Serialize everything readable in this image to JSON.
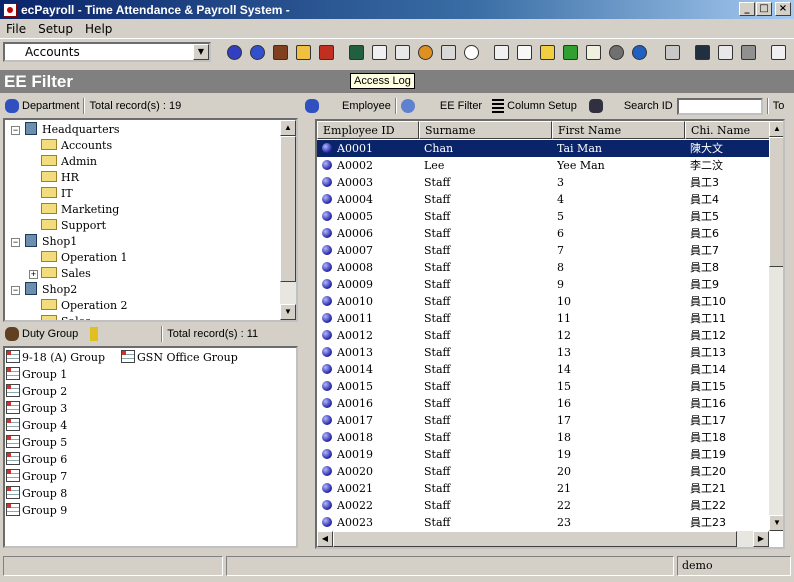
{
  "window": {
    "title": "ecPayroll - Time Attendance & Payroll System -"
  },
  "menu": [
    "File",
    "Setup",
    "Help"
  ],
  "toolbar": {
    "company_combo": "Accounts",
    "tooltip": "Access Log"
  },
  "section_title": "EE Filter",
  "department": {
    "label": "Department",
    "total": "Total record(s) : 19",
    "tree": [
      {
        "label": "Headquarters",
        "type": "building",
        "level": 0,
        "toggle": "−"
      },
      {
        "label": "Accounts",
        "type": "folder",
        "level": 1
      },
      {
        "label": "Admin",
        "type": "folder",
        "level": 1
      },
      {
        "label": "HR",
        "type": "folder",
        "level": 1
      },
      {
        "label": "IT",
        "type": "folder",
        "level": 1
      },
      {
        "label": "Marketing",
        "type": "folder",
        "level": 1
      },
      {
        "label": "Support",
        "type": "folder",
        "level": 1
      },
      {
        "label": "Shop1",
        "type": "building",
        "level": 0,
        "toggle": "−"
      },
      {
        "label": "Operation 1",
        "type": "folder",
        "level": 1
      },
      {
        "label": "Sales",
        "type": "folder",
        "level": 1,
        "toggle": "+"
      },
      {
        "label": "Shop2",
        "type": "building",
        "level": 0,
        "toggle": "−"
      },
      {
        "label": "Operation 2",
        "type": "folder",
        "level": 1
      },
      {
        "label": "Sales",
        "type": "folder",
        "level": 1
      }
    ]
  },
  "duty_group": {
    "label": "Duty Group",
    "total": "Total record(s) : 11",
    "groups": [
      "9-18 (A) Group",
      "GSN Office Group",
      "Group 1",
      "Group 2",
      "Group 3",
      "Group 4",
      "Group 5",
      "Group 6",
      "Group 7",
      "Group 8",
      "Group 9"
    ]
  },
  "employee_bar": {
    "employee": "Employee",
    "ee_filter": "EE Filter",
    "column_setup": "Column Setup",
    "search_id": "Search ID",
    "search_value": "",
    "to": "To"
  },
  "table": {
    "columns": [
      "Employee ID",
      "Surname",
      "First Name",
      "Chi. Name"
    ],
    "rows": [
      [
        "A0001",
        "Chan",
        "Tai Man",
        "陳大文"
      ],
      [
        "A0002",
        "Lee",
        "Yee Man",
        "李二汶"
      ],
      [
        "A0003",
        "Staff",
        "3",
        "員工3"
      ],
      [
        "A0004",
        "Staff",
        "4",
        "員工4"
      ],
      [
        "A0005",
        "Staff",
        "5",
        "員工5"
      ],
      [
        "A0006",
        "Staff",
        "6",
        "員工6"
      ],
      [
        "A0007",
        "Staff",
        "7",
        "員工7"
      ],
      [
        "A0008",
        "Staff",
        "8",
        "員工8"
      ],
      [
        "A0009",
        "Staff",
        "9",
        "員工9"
      ],
      [
        "A0010",
        "Staff",
        "10",
        "員工10"
      ],
      [
        "A0011",
        "Staff",
        "11",
        "員工11"
      ],
      [
        "A0012",
        "Staff",
        "12",
        "員工12"
      ],
      [
        "A0013",
        "Staff",
        "13",
        "員工13"
      ],
      [
        "A0014",
        "Staff",
        "14",
        "員工14"
      ],
      [
        "A0015",
        "Staff",
        "15",
        "員工15"
      ],
      [
        "A0016",
        "Staff",
        "16",
        "員工16"
      ],
      [
        "A0017",
        "Staff",
        "17",
        "員工17"
      ],
      [
        "A0018",
        "Staff",
        "18",
        "員工18"
      ],
      [
        "A0019",
        "Staff",
        "19",
        "員工19"
      ],
      [
        "A0020",
        "Staff",
        "20",
        "員工20"
      ],
      [
        "A0021",
        "Staff",
        "21",
        "員工21"
      ],
      [
        "A0022",
        "Staff",
        "22",
        "員工22"
      ],
      [
        "A0023",
        "Staff",
        "23",
        "員工23"
      ]
    ],
    "selected_row": 0
  },
  "status": {
    "user": "demo"
  }
}
